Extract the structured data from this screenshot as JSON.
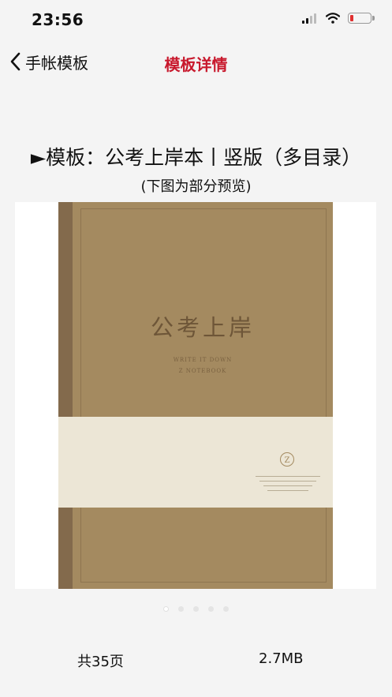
{
  "status_bar": {
    "time": "23:56",
    "battery_color": "#e03030"
  },
  "nav": {
    "back_label": "手帐模板",
    "title": "模板详情",
    "title_color": "#c8192d"
  },
  "template": {
    "title": "►模板：公考上岸本丨竖版（多目录）",
    "subtitle": "(下图为部分预览)"
  },
  "preview": {
    "cover_title": "公考上岸",
    "cover_line_1": "WRITE IT DOWN",
    "cover_line_2": "Z NOTEBOOK",
    "cover_color": "#a48a60",
    "band_color": "#ece6d6",
    "logo_letter": "Z",
    "current_page": 1,
    "total_pages": 5
  },
  "info": {
    "page_count": "共35页",
    "file_size": "2.7MB"
  }
}
